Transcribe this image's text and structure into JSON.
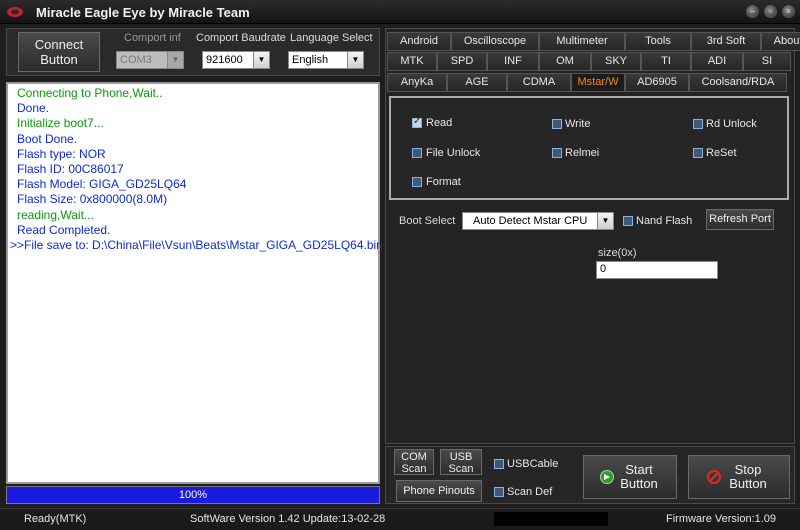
{
  "app": {
    "title": "Miracle Eagle Eye by Miracle Team"
  },
  "connect": {
    "label_line1": "Connect",
    "label_line2": "Button"
  },
  "comport": {
    "label": "Comport inf",
    "value": "COM3"
  },
  "baudrate": {
    "label": "Comport Baudrate",
    "value": "921600"
  },
  "language": {
    "label": "Language Select",
    "value": "English"
  },
  "log": {
    "lines": [
      "Connecting to Phone,Wait..",
      "Done.",
      "Initialize boot7...",
      "Boot Done.",
      "Flash  type: NOR",
      "Flash    ID: 00C86017",
      "Flash Model: GIGA_GD25LQ64",
      "Flash  Size: 0x800000(8.0M)",
      "reading,Wait...",
      "Read Completed.",
      ">>File save to: D:\\China\\File\\Vsun\\Beats\\Mstar_GIGA_GD25LQ64.bin"
    ]
  },
  "progress": {
    "percent": 100,
    "label": "100%"
  },
  "tabs": {
    "row1": [
      "Android",
      "Oscilloscope",
      "Multimeter",
      "Tools",
      "3rd Soft",
      "About"
    ],
    "row2": [
      "MTK",
      "SPD",
      "INF",
      "OM",
      "SKY",
      "TI",
      "ADI",
      "SI"
    ],
    "row3": [
      "AnyKa",
      "AGE",
      "CDMA",
      "Mstar/W",
      "AD6905",
      "Coolsand/RDA"
    ],
    "active": "Mstar/W"
  },
  "operations": {
    "read": "Read",
    "write": "Write",
    "rd_unlock": "Rd Unlock",
    "file_unlock": "File Unlock",
    "relmei": "Relmei",
    "reset": "ReSet",
    "format": "Format"
  },
  "boot": {
    "label": "Boot Select",
    "value": "Auto Detect Mstar CPU",
    "nand_flash": "Nand Flash",
    "refresh_port": "Refresh Port"
  },
  "size": {
    "label": "size(0x)",
    "value": "0"
  },
  "bottom": {
    "com_scan_1": "COM",
    "com_scan_2": "Scan",
    "usb_scan_1": "USB",
    "usb_scan_2": "Scan",
    "phone_pinouts": "Phone Pinouts",
    "usbcable": "USBCable",
    "scan_def": "Scan Def",
    "start_1": "Start",
    "start_2": "Button",
    "stop_1": "Stop",
    "stop_2": "Button"
  },
  "status": {
    "state": "Ready(MTK)",
    "software": "SoftWare Version 1.42  Update:13-02-28",
    "firmware": "Firmware Version:1.09"
  },
  "colors": {
    "log_green": "#0a9a0a",
    "log_blue": "#0d2ad8",
    "progress": "#1b1be0",
    "active_tab": "#f28a1e"
  }
}
